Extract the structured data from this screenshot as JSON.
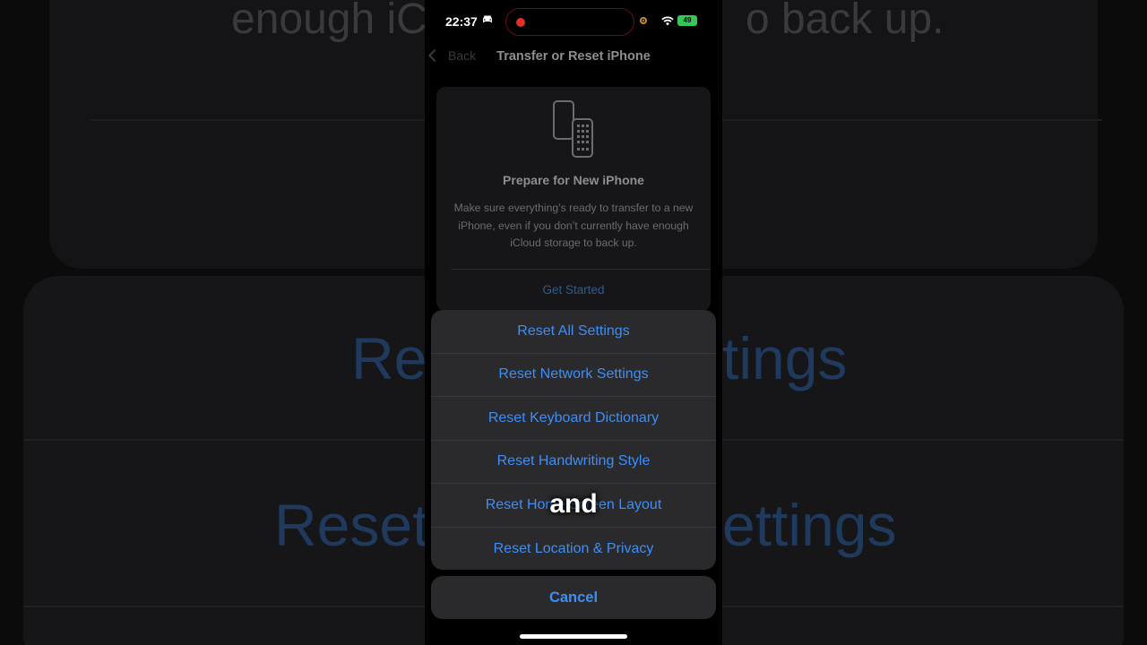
{
  "background": {
    "top_text": "enough iCloud storage to back up.",
    "mid_text_1": "Reset Network Settings",
    "mid_text_2": "Reset Keyboard Dictionary / Settings"
  },
  "status_bar": {
    "time": "22:37",
    "battery": "49"
  },
  "nav": {
    "back_label": "Back",
    "title": "Transfer or Reset iPhone"
  },
  "prepare_card": {
    "title": "Prepare for New iPhone",
    "description": "Make sure everything’s ready to transfer to a new iPhone, even if you don’t currently have enough iCloud storage to back up.",
    "action": "Get Started"
  },
  "reset_sheet": {
    "items": [
      "Reset All Settings",
      "Reset Network Settings",
      "Reset Keyboard Dictionary",
      "Reset Handwriting Style",
      "Reset Home Screen Layout",
      "Reset Location & Privacy"
    ],
    "cancel": "Cancel"
  },
  "caption": "and",
  "colors": {
    "accent": "#3d8ef7",
    "sheet_bg": "#2a2a2c",
    "record_dot": "#e0312b",
    "battery": "#34c759"
  }
}
